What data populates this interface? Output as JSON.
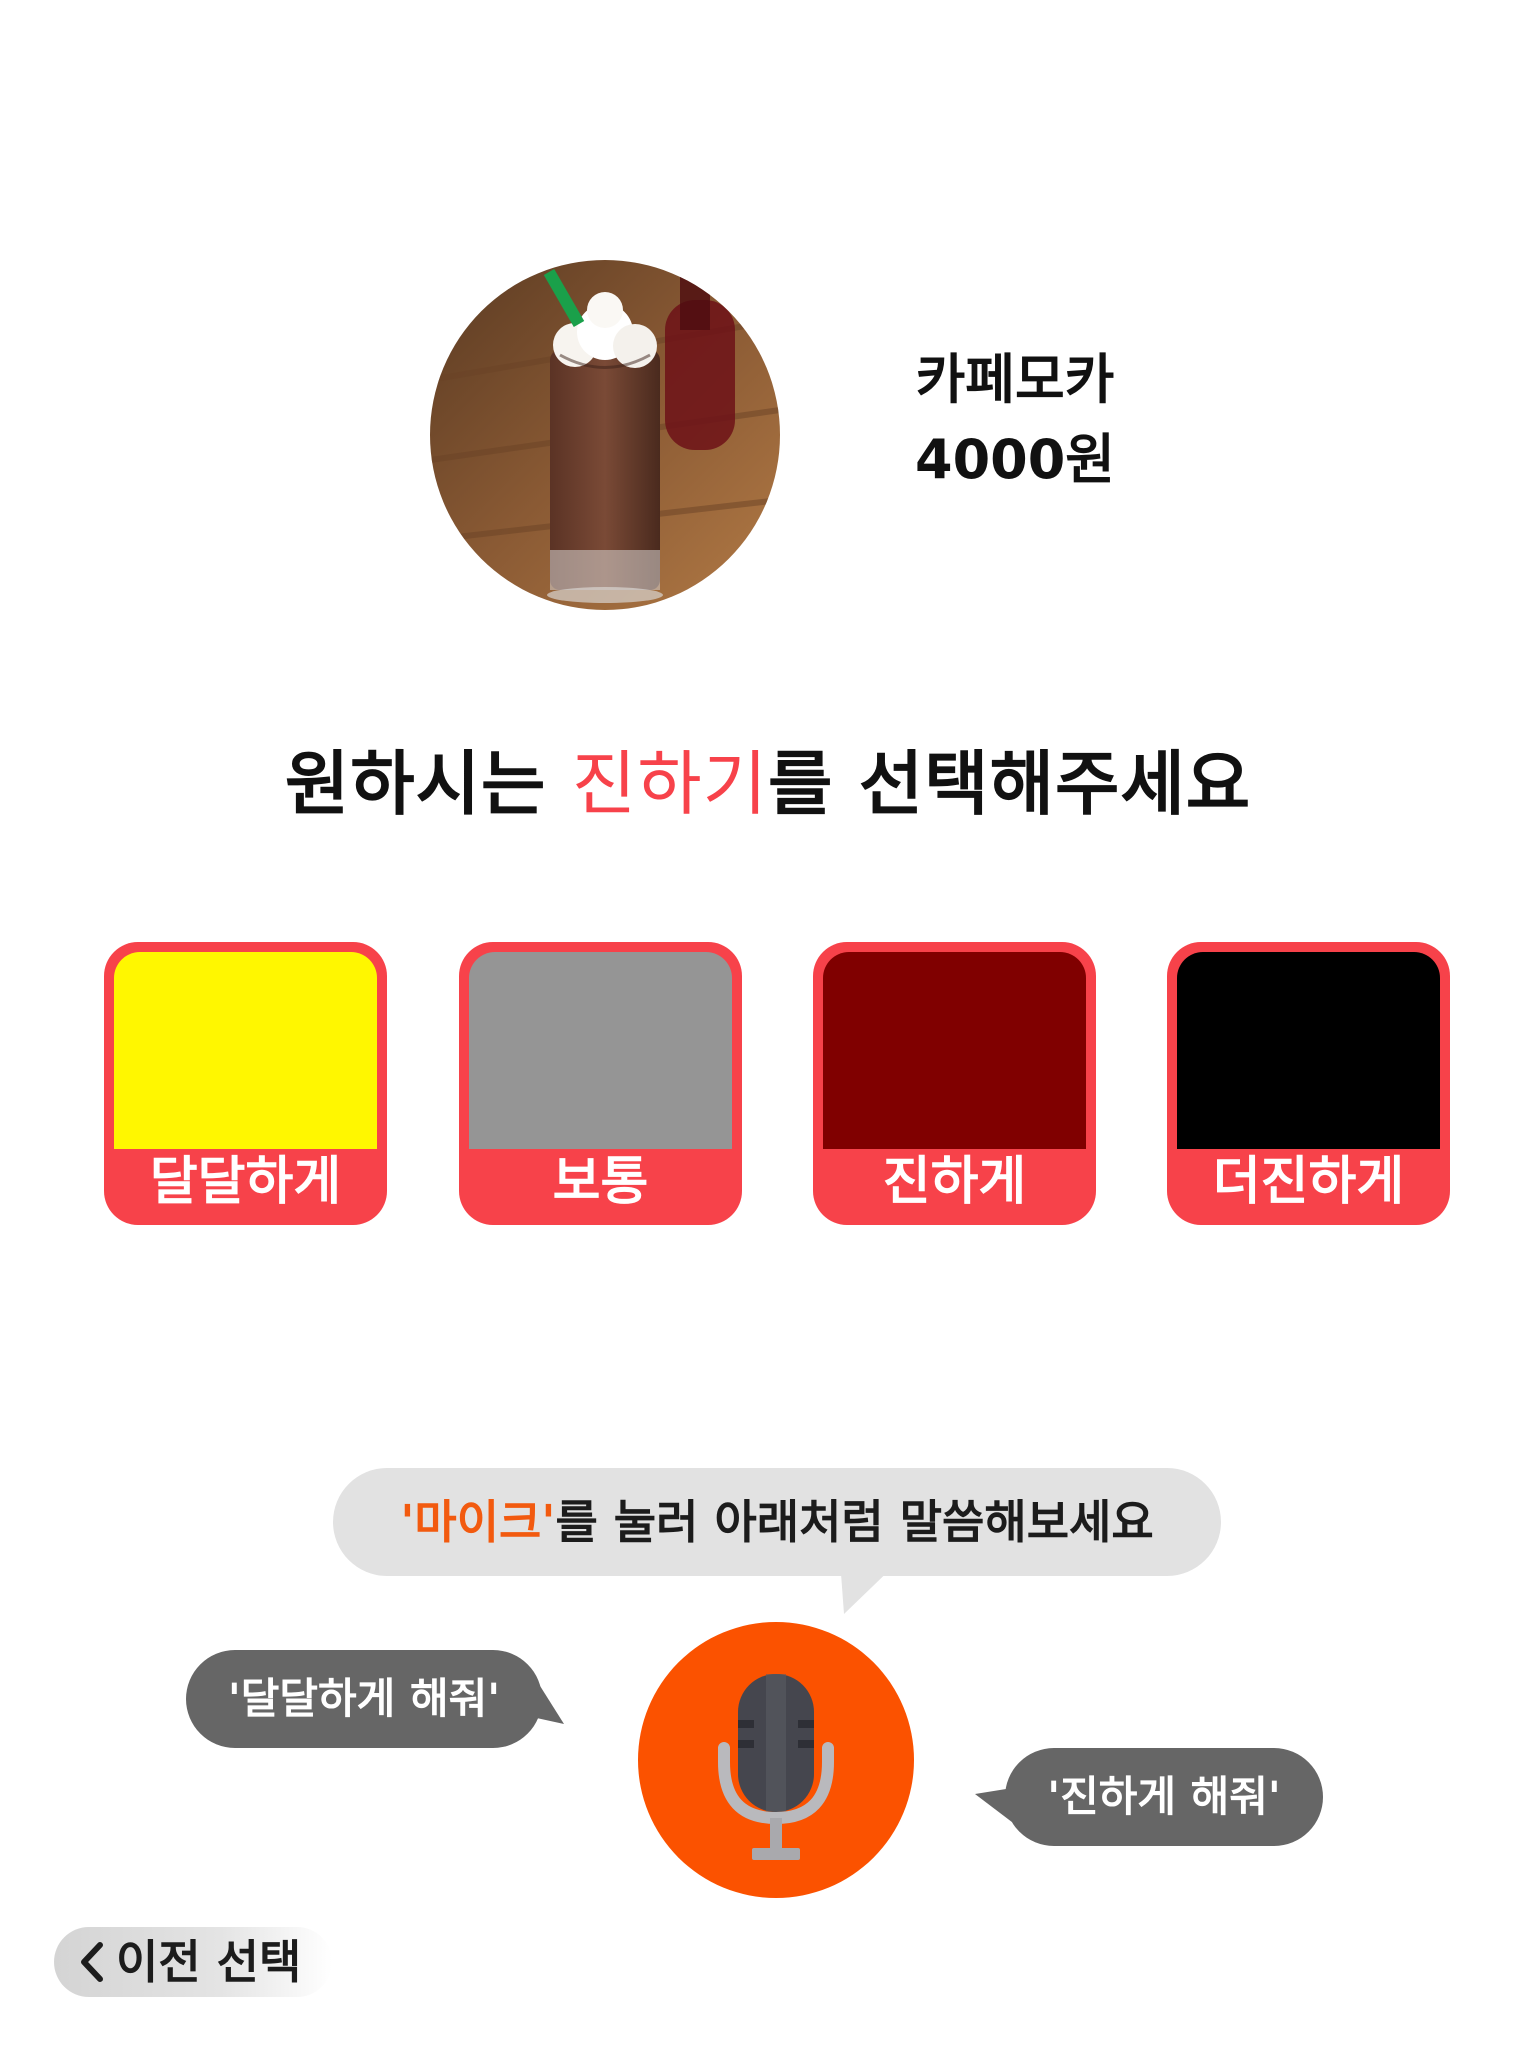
{
  "product": {
    "image_icon": "cafe-mocha-photo",
    "name": "카페모카",
    "price": "4000원"
  },
  "prompt": {
    "before": "원하시는 ",
    "highlight": "진하기",
    "after": "를 선택해주세요"
  },
  "options": [
    {
      "label": "달달하게",
      "color": "#fff700"
    },
    {
      "label": "보통",
      "color": "#959595"
    },
    {
      "label": "진하게",
      "color": "#800000"
    },
    {
      "label": "더진하게",
      "color": "#000000"
    }
  ],
  "voice": {
    "instruction_accent": "'마이크'",
    "instruction_rest": "를 눌러 아래처럼 말씀해보세요",
    "example_left": "'달달하게 해줘'",
    "example_right": "'진하게 해줘'",
    "mic_icon": "microphone-icon"
  },
  "nav": {
    "back_label": "이전 선택",
    "back_icon": "chevron-left-icon"
  },
  "colors": {
    "accent_red": "#f7424a",
    "mic_orange": "#fb5200",
    "bubble_dark": "#666666",
    "bubble_light": "#e2e2e2"
  }
}
